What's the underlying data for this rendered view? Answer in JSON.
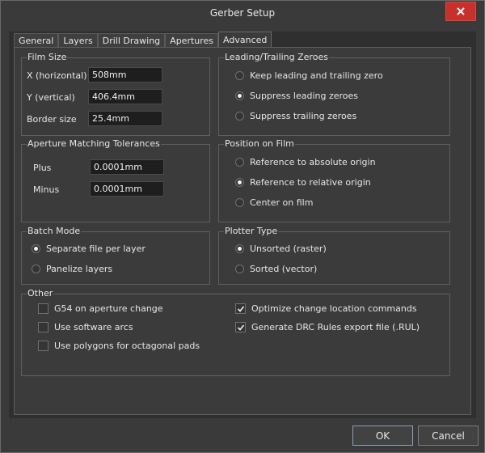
{
  "window": {
    "title": "Gerber Setup",
    "close_icon": "close-icon"
  },
  "tabs": [
    {
      "label": "General",
      "active": false
    },
    {
      "label": "Layers",
      "active": false
    },
    {
      "label": "Drill Drawing",
      "active": false
    },
    {
      "label": "Apertures",
      "active": false
    },
    {
      "label": "Advanced",
      "active": true
    }
  ],
  "film_size": {
    "title": "Film Size",
    "x_label": "X (horizontal)",
    "x_value": "508mm",
    "y_label": "Y (vertical)",
    "y_value": "406.4mm",
    "border_label": "Border size",
    "border_value": "25.4mm"
  },
  "aperture_tolerances": {
    "title": "Aperture Matching Tolerances",
    "plus_label": "Plus",
    "plus_value": "0.0001mm",
    "minus_label": "Minus",
    "minus_value": "0.0001mm"
  },
  "batch_mode": {
    "title": "Batch Mode",
    "options": [
      {
        "label": "Separate file per layer",
        "selected": true
      },
      {
        "label": "Panelize layers",
        "selected": false
      }
    ]
  },
  "leading_trailing": {
    "title": "Leading/Trailing Zeroes",
    "options": [
      {
        "label": "Keep leading and trailing zero",
        "selected": false
      },
      {
        "label": "Suppress leading zeroes",
        "selected": true
      },
      {
        "label": "Suppress trailing zeroes",
        "selected": false
      }
    ]
  },
  "position_on_film": {
    "title": "Position on Film",
    "options": [
      {
        "label": "Reference to absolute origin",
        "selected": false
      },
      {
        "label": "Reference to relative origin",
        "selected": true
      },
      {
        "label": "Center on film",
        "selected": false
      }
    ]
  },
  "plotter_type": {
    "title": "Plotter Type",
    "options": [
      {
        "label": "Unsorted (raster)",
        "selected": true
      },
      {
        "label": "Sorted (vector)",
        "selected": false
      }
    ]
  },
  "other": {
    "title": "Other",
    "checks": [
      {
        "label": "G54 on aperture change",
        "checked": false
      },
      {
        "label": "Use software arcs",
        "checked": false
      },
      {
        "label": "Use polygons for octagonal pads",
        "checked": false
      },
      {
        "label": "Optimize change location commands",
        "checked": true
      },
      {
        "label": "Generate DRC Rules export file (.RUL)",
        "checked": true
      }
    ]
  },
  "buttons": {
    "ok": "OK",
    "cancel": "Cancel"
  }
}
